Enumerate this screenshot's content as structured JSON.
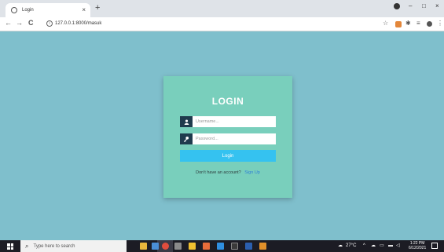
{
  "browser": {
    "tab_title": "Login",
    "tab_close": "×",
    "new_tab": "+",
    "url": "127.0.0.1:8000/masuk",
    "nav": {
      "back": "←",
      "forward": "→",
      "reload": "C"
    },
    "window_controls": {
      "minimize": "–",
      "maximize": "□",
      "close": "×"
    }
  },
  "login": {
    "title": "LOGIN",
    "username_placeholder": "Username...",
    "password_placeholder": "Password...",
    "button_label": "Login",
    "signup_prompt": "Don't have an account?",
    "signup_link": "Sign Up"
  },
  "taskbar": {
    "search_placeholder": "Type here to search",
    "weather": "27°C",
    "time": "1:22 PM",
    "date": "6/12/2021"
  },
  "colors": {
    "page_bg": "#7fbfcc",
    "card_bg": "#79cfbc",
    "button": "#35c2f0",
    "icon_box": "#1f3b4d",
    "link": "#2f7fd6"
  }
}
